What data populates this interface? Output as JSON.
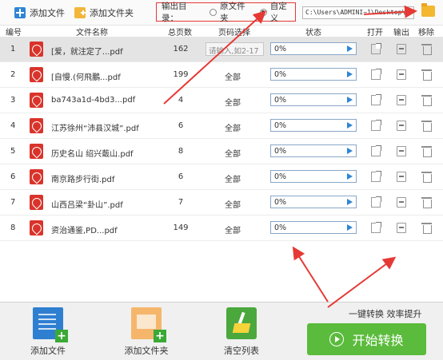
{
  "toolbar": {
    "add_file": "添加文件",
    "add_folder": "添加文件夹",
    "output_label": "输出目录：",
    "option_source": "原文件夹",
    "option_custom": "自定义",
    "selected_option": "自定义",
    "path": "C:\\Users\\ADMINI~1\\Desktop\\"
  },
  "columns": {
    "index": "编号",
    "filename": "文件名称",
    "pages": "总页数",
    "range": "页码选择",
    "status": "状态",
    "open": "打开",
    "output": "输出",
    "remove": "移除"
  },
  "files": [
    {
      "index": "1",
      "name": "[爱，就注定了...pdf",
      "pages": "162",
      "range": "请输入,如2-17",
      "progress": "0%"
    },
    {
      "index": "2",
      "name": "[自慢.(何飛鵬...pdf",
      "pages": "199",
      "range": "全部",
      "progress": "0%"
    },
    {
      "index": "3",
      "name": "ba743a1d-4bd3...pdf",
      "pages": "4",
      "range": "全部",
      "progress": "0%"
    },
    {
      "index": "4",
      "name": "江苏徐州“沛县汉城”.pdf",
      "pages": "6",
      "range": "全部",
      "progress": "0%"
    },
    {
      "index": "5",
      "name": "历史名山 绍兴蕺山.pdf",
      "pages": "8",
      "range": "全部",
      "progress": "0%"
    },
    {
      "index": "6",
      "name": "南京路步行街.pdf",
      "pages": "6",
      "range": "全部",
      "progress": "0%"
    },
    {
      "index": "7",
      "name": "山西吕梁“卦山”.pdf",
      "pages": "7",
      "range": "全部",
      "progress": "0%"
    },
    {
      "index": "8",
      "name": "资治通鉴,PD...pdf",
      "pages": "149",
      "range": "全部",
      "progress": "0%"
    }
  ],
  "bottom": {
    "add_file": "添加文件",
    "add_folder": "添加文件夹",
    "clear_list": "清空列表",
    "tagline": "一键转换  效率提升",
    "start": "开始转换"
  },
  "colors": {
    "accent_blue": "#2f86d6",
    "start_green": "#5bbb3c",
    "pdf_red": "#d9342b",
    "annotation_red": "#e53935"
  }
}
